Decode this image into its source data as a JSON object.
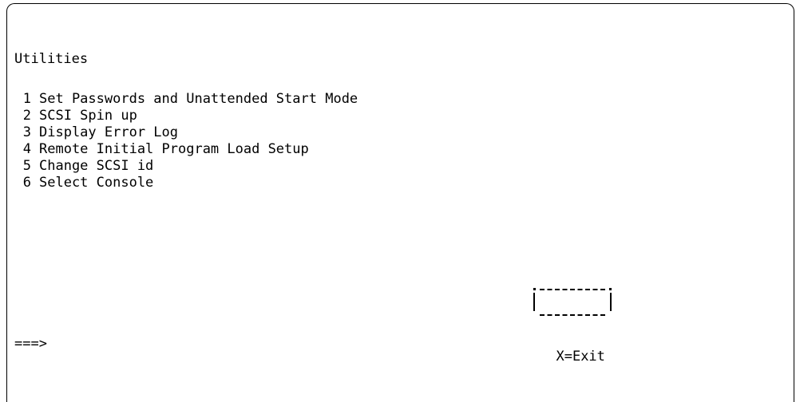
{
  "screen": {
    "title": "Utilities",
    "menu_items": [
      {
        "number": "1",
        "label": "Set Passwords and Unattended Start Mode"
      },
      {
        "number": "2",
        "label": "SCSI Spin up"
      },
      {
        "number": "3",
        "label": "Display Error Log"
      },
      {
        "number": "4",
        "label": "Remote Initial Program Load Setup"
      },
      {
        "number": "5",
        "label": "Change SCSI id"
      },
      {
        "number": "6",
        "label": "Select Console"
      }
    ],
    "exit_label": "X=Exit",
    "prompt": "===>",
    "command_value": ""
  }
}
